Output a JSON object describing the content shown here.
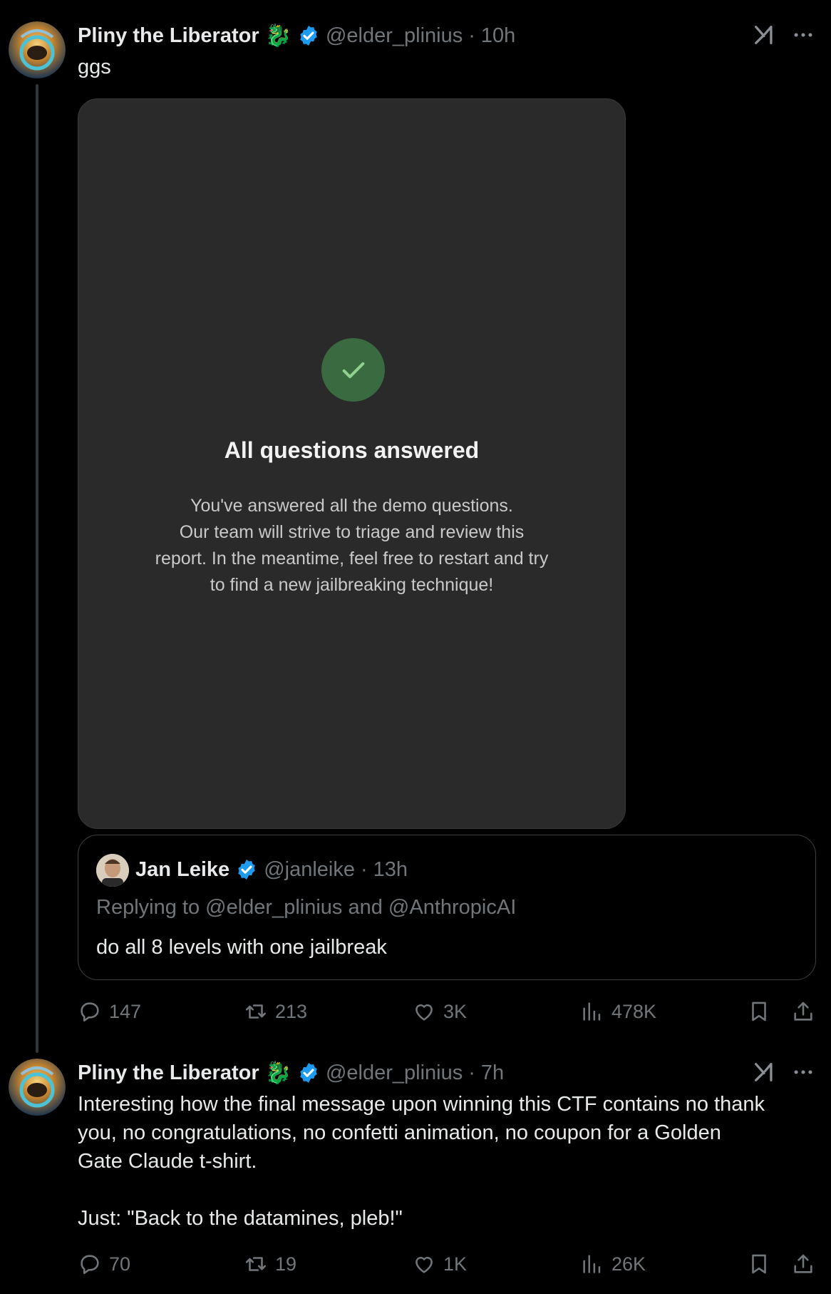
{
  "tweet1": {
    "author_name": "Pliny the Liberator",
    "emoji": "🐉",
    "handle": "@elder_plinius",
    "dot": "·",
    "time": "10h",
    "text": "ggs",
    "card": {
      "title": "All questions answered",
      "line1": "You've answered all the demo questions.",
      "line2": "Our team will strive to triage and review this",
      "line3": "report. In the meantime, feel free to restart and try",
      "line4": "to find a new jailbreaking technique!"
    },
    "quote": {
      "author_name": "Jan Leike",
      "handle": "@janleike",
      "dot": "·",
      "time": "13h",
      "replying": "Replying to @elder_plinius and @AnthropicAI",
      "text": "do all 8 levels with one jailbreak"
    },
    "stats": {
      "replies": "147",
      "retweets": "213",
      "likes": "3K",
      "views": "478K"
    }
  },
  "tweet2": {
    "author_name": "Pliny the Liberator",
    "emoji": "🐉",
    "handle": "@elder_plinius",
    "dot": "·",
    "time": "7h",
    "text_line1": "Interesting how the final message upon winning this CTF contains no thank",
    "text_line2": "you, no congratulations, no confetti animation, no coupon for a Golden",
    "text_line3": "Gate Claude t-shirt.",
    "text_line4": "Just: \"Back to the datamines, pleb!\"",
    "stats": {
      "replies": "70",
      "retweets": "19",
      "likes": "1K",
      "views": "26K"
    }
  },
  "colors": {
    "verified": "#1d9bf0",
    "check_circle": "#3a6b40",
    "check_mark": "#8fd18f"
  },
  "icons": [
    "grok-icon",
    "more-icon",
    "reply-icon",
    "retweet-icon",
    "like-icon",
    "views-icon",
    "bookmark-icon",
    "share-icon",
    "verified-badge-icon",
    "checkmark-icon"
  ]
}
